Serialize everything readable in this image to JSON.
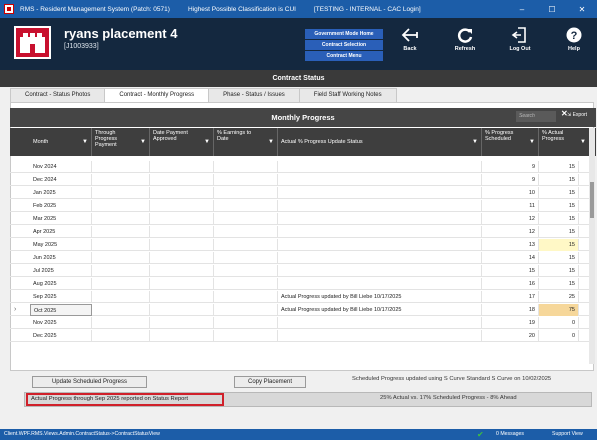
{
  "window": {
    "title": "RMS - Resident Management System (Patch: 0571)",
    "classification": "Highest Possible Classification is CUI",
    "env": "[TESTING - INTERNAL - CAC Login]",
    "min": "–",
    "max": "☐",
    "close": "✕"
  },
  "header": {
    "project_title": "ryans placement 4",
    "project_id": "[J1003933]",
    "gov_menu": [
      "Government Mode Home",
      "Contract Selection",
      "Contract Menu"
    ],
    "buttons": {
      "back": "Back",
      "refresh": "Refresh",
      "logout": "Log Out",
      "help": "Help"
    }
  },
  "section_title": "Contract Status",
  "tabs": [
    "Contract - Status Photos",
    "Contract - Monthly Progress",
    "Phase - Status / Issues",
    "Field Staff Working Notes"
  ],
  "active_tab": 1,
  "grid": {
    "title": "Monthly Progress",
    "search_placeholder": "Search",
    "export_label": "Export",
    "columns": [
      "Month",
      "Through Progress Payment",
      "Date Payment Approved",
      "% Earnings to Date",
      "Actual % Progress Update Status",
      "% Progress Scheduled",
      "% Actual Progress"
    ],
    "rows": [
      {
        "month": "Nov 2024",
        "status": "",
        "sched": "9",
        "actual": "15"
      },
      {
        "month": "Dec 2024",
        "status": "",
        "sched": "9",
        "actual": "15"
      },
      {
        "month": "Jan 2025",
        "status": "",
        "sched": "10",
        "actual": "15"
      },
      {
        "month": "Feb 2025",
        "status": "",
        "sched": "11",
        "actual": "15"
      },
      {
        "month": "Mar 2025",
        "status": "",
        "sched": "12",
        "actual": "15"
      },
      {
        "month": "Apr 2025",
        "status": "",
        "sched": "12",
        "actual": "15"
      },
      {
        "month": "May 2025",
        "status": "",
        "sched": "13",
        "actual": "15"
      },
      {
        "month": "Jun 2025",
        "status": "",
        "sched": "14",
        "actual": "15"
      },
      {
        "month": "Jul 2025",
        "status": "",
        "sched": "15",
        "actual": "15"
      },
      {
        "month": "Aug 2025",
        "status": "",
        "sched": "16",
        "actual": "15"
      },
      {
        "month": "Sep 2025",
        "status": "Actual Progress updated by Bill  Liebe 10/17/2025",
        "sched": "17",
        "actual": "25"
      },
      {
        "month": "Oct 2025",
        "status": "Actual Progress updated by Bill  Liebe 10/17/2025",
        "sched": "18",
        "actual": "75"
      },
      {
        "month": "Nov 2025",
        "status": "",
        "sched": "19",
        "actual": "0"
      },
      {
        "month": "Dec 2025",
        "status": "",
        "sched": "20",
        "actual": "0"
      }
    ]
  },
  "actions": {
    "update_scheduled": "Update Scheduled Progress",
    "copy_placement": "Copy Placement",
    "scheduled_note": "Scheduled Progress updated using S Curve Standard S Curve on 10/02/2025"
  },
  "status": {
    "left": "Actual Progress through Sep 2025 reported on Status Report",
    "right": "25% Actual vs. 17% Scheduled Progress - 8% Ahead"
  },
  "footer": {
    "path": "Client.WPF.RMS.Views.Admin.ContractStatus->ContractStatusView",
    "messages": "0 Messages",
    "support": "Support View"
  },
  "colors": {
    "titlebar": "#1c5da8",
    "header": "#14283f",
    "highlight_red": "#d0202a",
    "cell_yellow": "#fff8c6",
    "cell_orange": "#f6d79a"
  }
}
